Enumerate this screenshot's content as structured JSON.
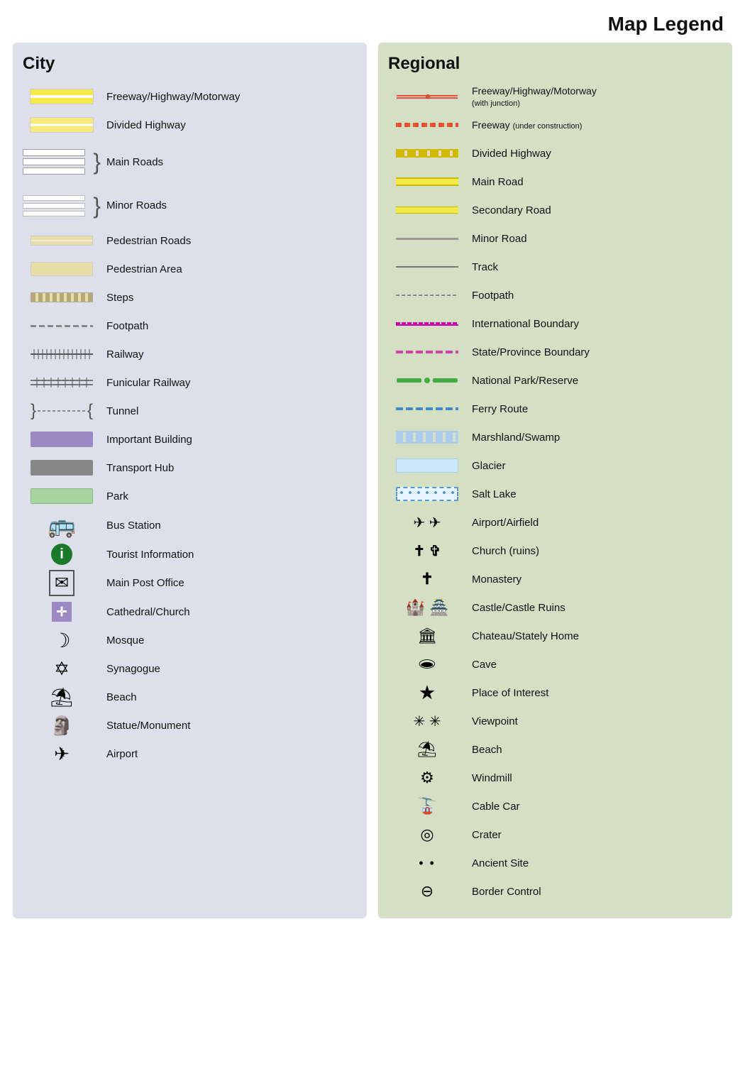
{
  "title": "Map Legend",
  "city": {
    "heading": "City",
    "items": [
      {
        "label": "Freeway/Highway/Motorway",
        "symbol_type": "freeway-city"
      },
      {
        "label": "Divided Highway",
        "symbol_type": "divided-hwy-city"
      },
      {
        "label": "Main Roads",
        "symbol_type": "main-roads-bracket"
      },
      {
        "label": "Minor Roads",
        "symbol_type": "minor-roads-bracket"
      },
      {
        "label": "Pedestrian Roads",
        "symbol_type": "pedestrian-road"
      },
      {
        "label": "Pedestrian Area",
        "symbol_type": "pedestrian-area"
      },
      {
        "label": "Steps",
        "symbol_type": "steps"
      },
      {
        "label": "Footpath",
        "symbol_type": "footpath-city"
      },
      {
        "label": "Railway",
        "symbol_type": "railway"
      },
      {
        "label": "Funicular Railway",
        "symbol_type": "funicular"
      },
      {
        "label": "Tunnel",
        "symbol_type": "tunnel"
      },
      {
        "label": "Important Building",
        "symbol_type": "important-building"
      },
      {
        "label": "Transport Hub",
        "symbol_type": "transport-hub"
      },
      {
        "label": "Park",
        "symbol_type": "park"
      },
      {
        "label": "Bus Station",
        "symbol_type": "icon-bus",
        "icon": "🚌"
      },
      {
        "label": "Tourist Information",
        "symbol_type": "icon-info",
        "icon": "ℹ"
      },
      {
        "label": "Main Post Office",
        "symbol_type": "icon-post",
        "icon": "✉"
      },
      {
        "label": "Cathedral/Church",
        "symbol_type": "icon-church",
        "icon": "✛"
      },
      {
        "label": "Mosque",
        "symbol_type": "icon-mosque",
        "icon": "☽"
      },
      {
        "label": "Synagogue",
        "symbol_type": "icon-synagogue",
        "icon": "✡"
      },
      {
        "label": "Beach",
        "symbol_type": "icon-beach",
        "icon": "⛱"
      },
      {
        "label": "Statue/Monument",
        "symbol_type": "icon-monument",
        "icon": "🗿"
      },
      {
        "label": "Airport",
        "symbol_type": "icon-airport",
        "icon": "✈"
      }
    ]
  },
  "regional": {
    "heading": "Regional",
    "items": [
      {
        "label": "Freeway/Highway/Motorway (with junction)",
        "symbol_type": "reg-freeway-junction"
      },
      {
        "label": "Freeway (under construction)",
        "symbol_type": "reg-freeway-construction"
      },
      {
        "label": "Divided Highway",
        "symbol_type": "reg-divided-hwy"
      },
      {
        "label": "Main Road",
        "symbol_type": "reg-main-road"
      },
      {
        "label": "Secondary Road",
        "symbol_type": "reg-secondary-road"
      },
      {
        "label": "Minor Road",
        "symbol_type": "reg-minor-road"
      },
      {
        "label": "Track",
        "symbol_type": "reg-track"
      },
      {
        "label": "Footpath",
        "symbol_type": "reg-footpath"
      },
      {
        "label": "International Boundary",
        "symbol_type": "reg-intl-boundary"
      },
      {
        "label": "State/Province Boundary",
        "symbol_type": "reg-state-boundary"
      },
      {
        "label": "National Park/Reserve",
        "symbol_type": "reg-nat-park"
      },
      {
        "label": "Ferry Route",
        "symbol_type": "reg-ferry"
      },
      {
        "label": "Marshland/Swamp",
        "symbol_type": "reg-marsh"
      },
      {
        "label": "Glacier",
        "symbol_type": "reg-glacier"
      },
      {
        "label": "Salt Lake",
        "symbol_type": "reg-salt-lake"
      },
      {
        "label": "Airport/Airfield",
        "symbol_type": "reg-airport",
        "icon": "✈"
      },
      {
        "label": "Church (ruins)",
        "symbol_type": "reg-church",
        "icon": "✝"
      },
      {
        "label": "Monastery",
        "symbol_type": "reg-monastery",
        "icon": "✝"
      },
      {
        "label": "Castle/Castle Ruins",
        "symbol_type": "reg-castle",
        "icon": "🏰"
      },
      {
        "label": "Chateau/Stately Home",
        "symbol_type": "reg-chateau",
        "icon": "🏛"
      },
      {
        "label": "Cave",
        "symbol_type": "reg-cave",
        "icon": "🕳"
      },
      {
        "label": "Place of Interest",
        "symbol_type": "reg-place",
        "icon": "★"
      },
      {
        "label": "Viewpoint",
        "symbol_type": "reg-viewpoint"
      },
      {
        "label": "Beach",
        "symbol_type": "reg-beach",
        "icon": "⛱"
      },
      {
        "label": "Windmill",
        "symbol_type": "reg-windmill",
        "icon": "⚙"
      },
      {
        "label": "Cable Car",
        "symbol_type": "reg-cablecar",
        "icon": "🚡"
      },
      {
        "label": "Crater",
        "symbol_type": "reg-crater",
        "icon": "◎"
      },
      {
        "label": "Ancient Site",
        "symbol_type": "reg-ancient"
      },
      {
        "label": "Border Control",
        "symbol_type": "reg-border",
        "icon": "⊖"
      }
    ]
  }
}
